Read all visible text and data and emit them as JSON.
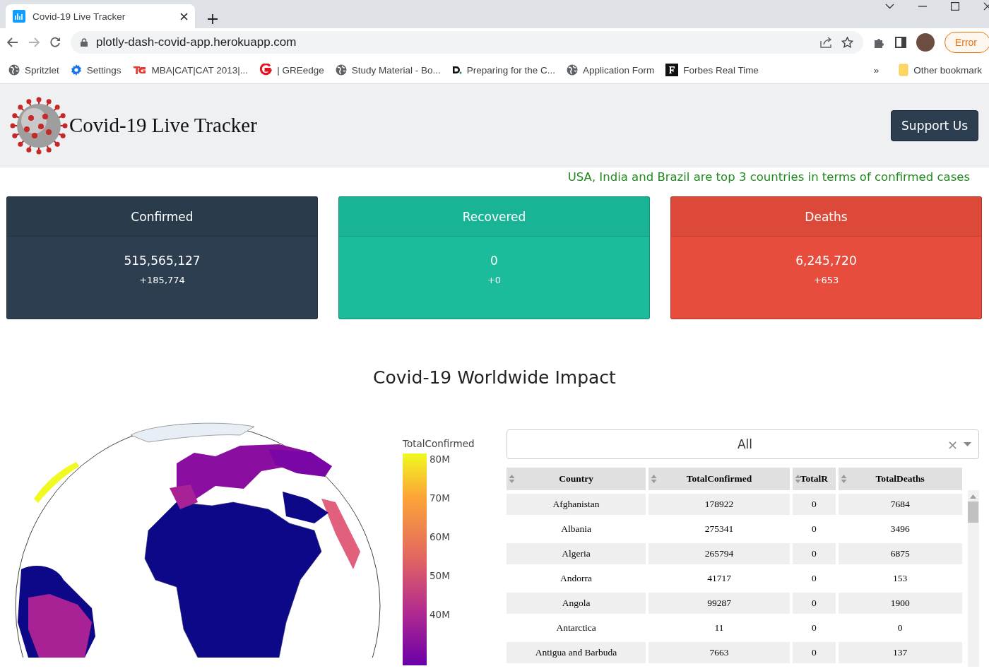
{
  "browser": {
    "tab": {
      "title": "Covid-19 Live Tracker",
      "selected": true
    },
    "address": "plotly-dash-covid-app.herokuapp.com",
    "error_button": "Error",
    "bookmarks": [
      {
        "kind": "globe",
        "label": "Spritzlet"
      },
      {
        "kind": "gear",
        "label": "Settings"
      },
      {
        "kind": "tg",
        "label": "MBA|CAT|CAT 2013|..."
      },
      {
        "kind": "g",
        "label": "| GREedge"
      },
      {
        "kind": "globe",
        "label": "Study Material - Bo..."
      },
      {
        "kind": "d",
        "label": "Preparing for the C..."
      },
      {
        "kind": "globe",
        "label": "Application Form"
      },
      {
        "kind": "f",
        "label": "Forbes Real Time"
      }
    ],
    "more": "»",
    "other_bookmarks": "Other bookmark"
  },
  "header": {
    "title": "Covid-19 Live Tracker",
    "support_button": "Support Us"
  },
  "tagline": "USA, India and Brazil are top 3 countries in terms of confirmed cases",
  "cards": [
    {
      "title": "Confirmed",
      "value": "515,565,127",
      "change": "+185,774",
      "color": "#2c3e50"
    },
    {
      "title": "Recovered",
      "value": "0",
      "change": "+0",
      "color": "#1abc9c"
    },
    {
      "title": "Deaths",
      "value": "6,245,720",
      "change": "+653",
      "color": "#e74c3c"
    }
  ],
  "section_title": "Covid-19 Worldwide Impact",
  "colorbar": {
    "title": "TotalConfirmed",
    "ticks": [
      "80M",
      "70M",
      "60M",
      "50M",
      "40M"
    ]
  },
  "dropdown": {
    "value": "All",
    "clear": "×"
  },
  "table": {
    "columns": [
      "Country",
      "TotalConfirmed",
      "TotalR",
      "TotalDeaths"
    ],
    "rows": [
      [
        "Afghanistan",
        "178922",
        "0",
        "7684"
      ],
      [
        "Albania",
        "275341",
        "0",
        "3496"
      ],
      [
        "Algeria",
        "265794",
        "0",
        "6875"
      ],
      [
        "Andorra",
        "41717",
        "0",
        "153"
      ],
      [
        "Angola",
        "99287",
        "0",
        "1900"
      ],
      [
        "Antarctica",
        "11",
        "0",
        "0"
      ],
      [
        "Antigua and Barbuda",
        "7663",
        "0",
        "137"
      ]
    ]
  }
}
